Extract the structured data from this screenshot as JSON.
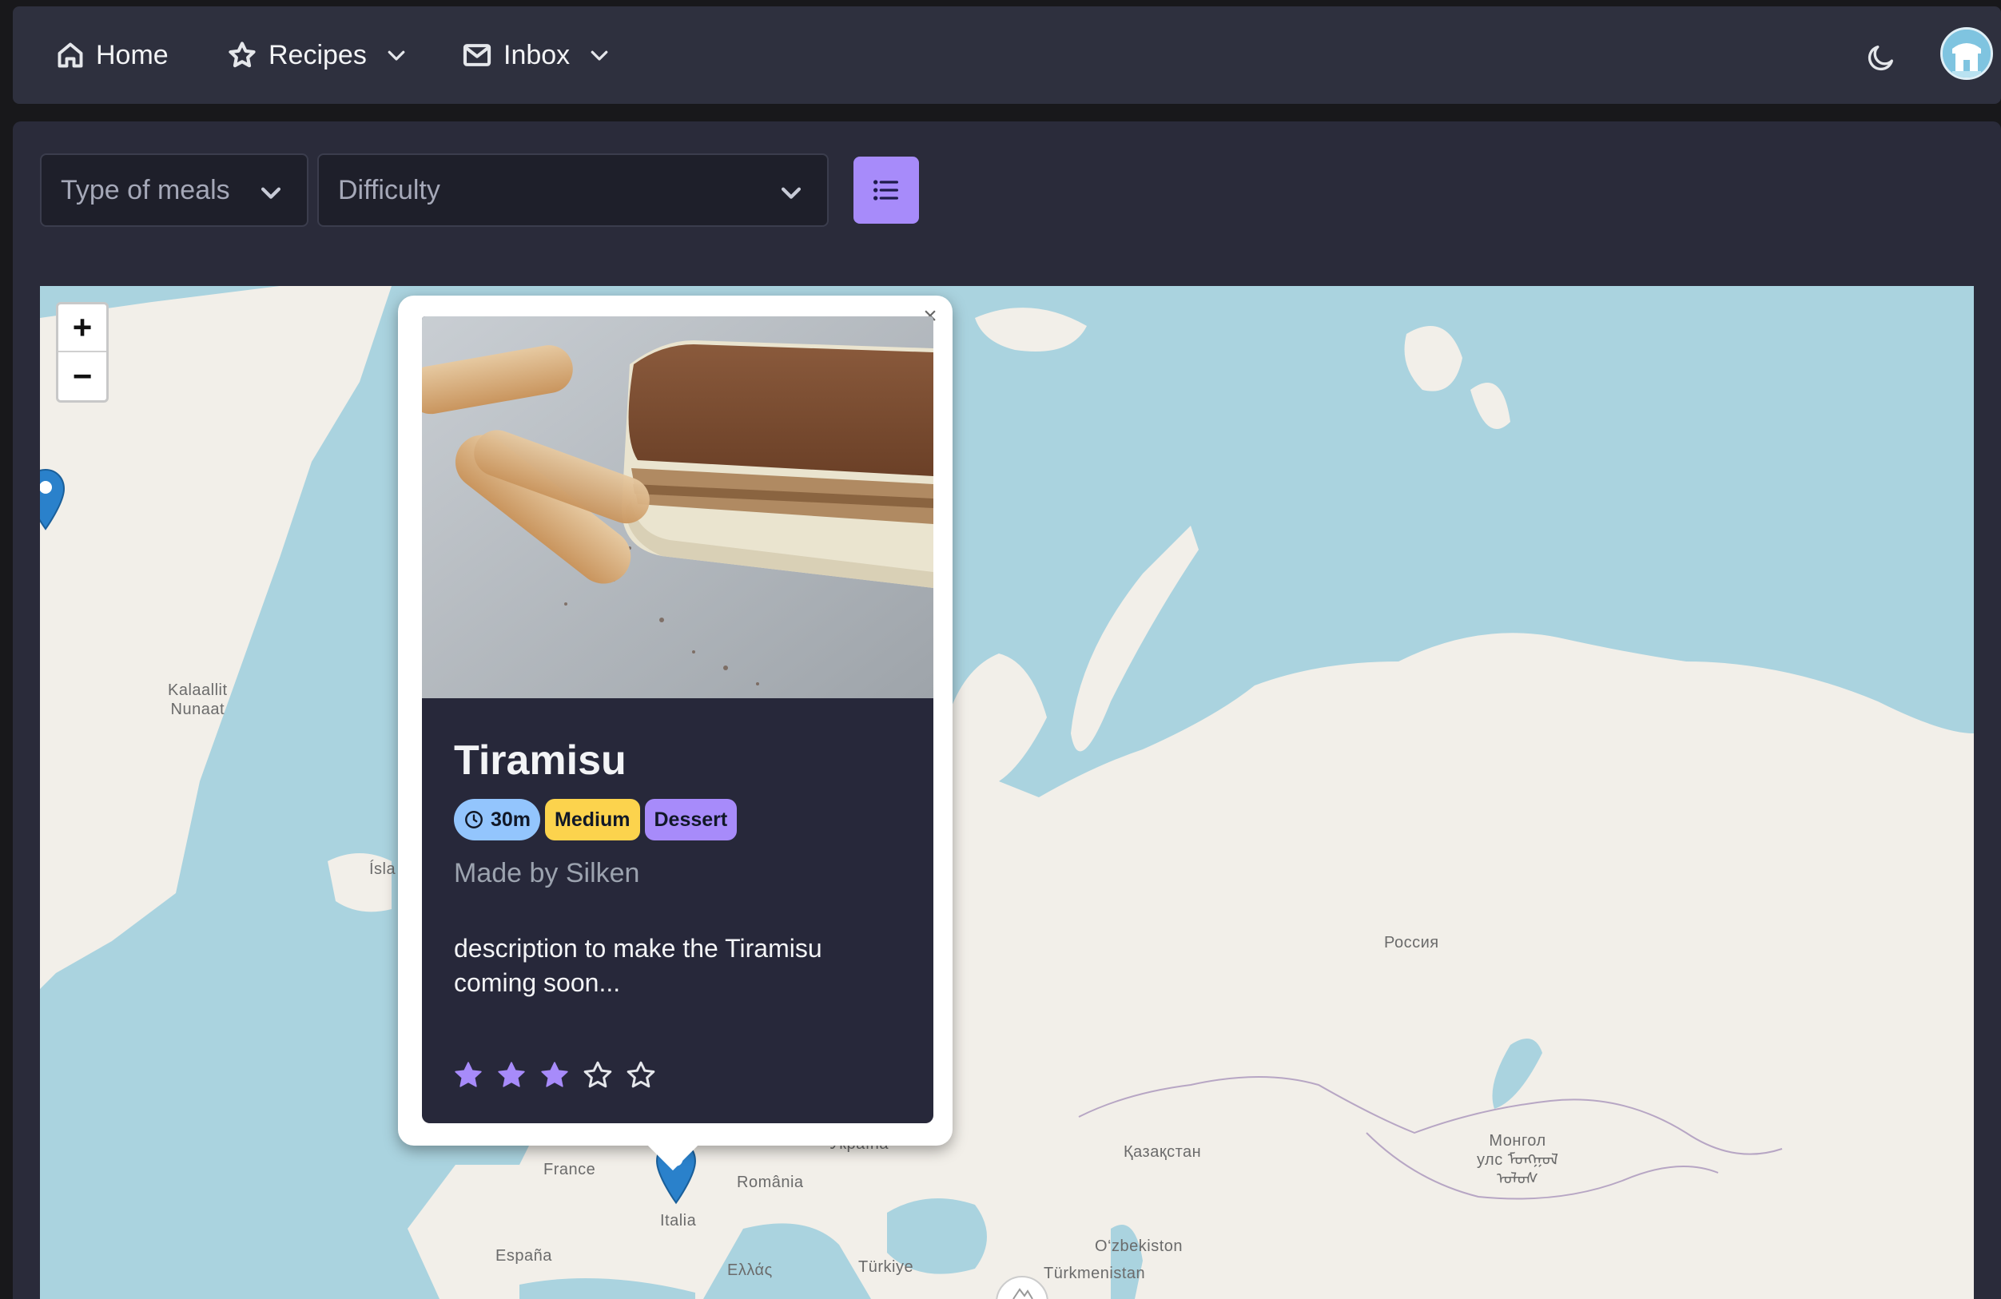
{
  "nav": {
    "home_label": "Home",
    "recipes_label": "Recipes",
    "inbox_label": "Inbox",
    "icons": [
      "home-icon",
      "star-icon",
      "mail-icon",
      "chevron-down-icon",
      "moon-icon"
    ]
  },
  "filters": {
    "type_placeholder": "Type of meals",
    "difficulty_placeholder": "Difficulty",
    "list_button_icon": "list-icon"
  },
  "map": {
    "zoom_in": "+",
    "zoom_out": "−",
    "labels": {
      "greenland": "Kalaallit\nNunaat",
      "island": "Ísla",
      "russia": "Россия",
      "kazakhstan": "Қазақстан",
      "mongolia": "Монгол\nулс ᠮᠣᠩᠭᠣᠯ\nᠤᠯᠤᠰ",
      "ukraine": "Україна",
      "france": "France",
      "romania": "România",
      "italy": "Italia",
      "spain": "España",
      "greece": "Ελλάς",
      "turkey": "Türkiye",
      "uzbekistan": "O‘zbekiston",
      "turkmenistan": "Türkmenistan"
    }
  },
  "popup": {
    "close": "×",
    "recipe": {
      "title": "Tiramisu",
      "time": "30m",
      "difficulty": "Medium",
      "type": "Dessert",
      "author": "Made by Silken",
      "description": "description to make the Tiramisu coming soon...",
      "rating": 3,
      "max_rating": 5
    }
  },
  "colors": {
    "accent": "#a78bfa",
    "time_badge": "#93c5fd",
    "difficulty_badge": "#fcd34d",
    "navbar": "#2e303e",
    "card": "#27283a",
    "sea": "#aad3df",
    "land": "#f2efe9",
    "marker": "#2a81cb"
  }
}
